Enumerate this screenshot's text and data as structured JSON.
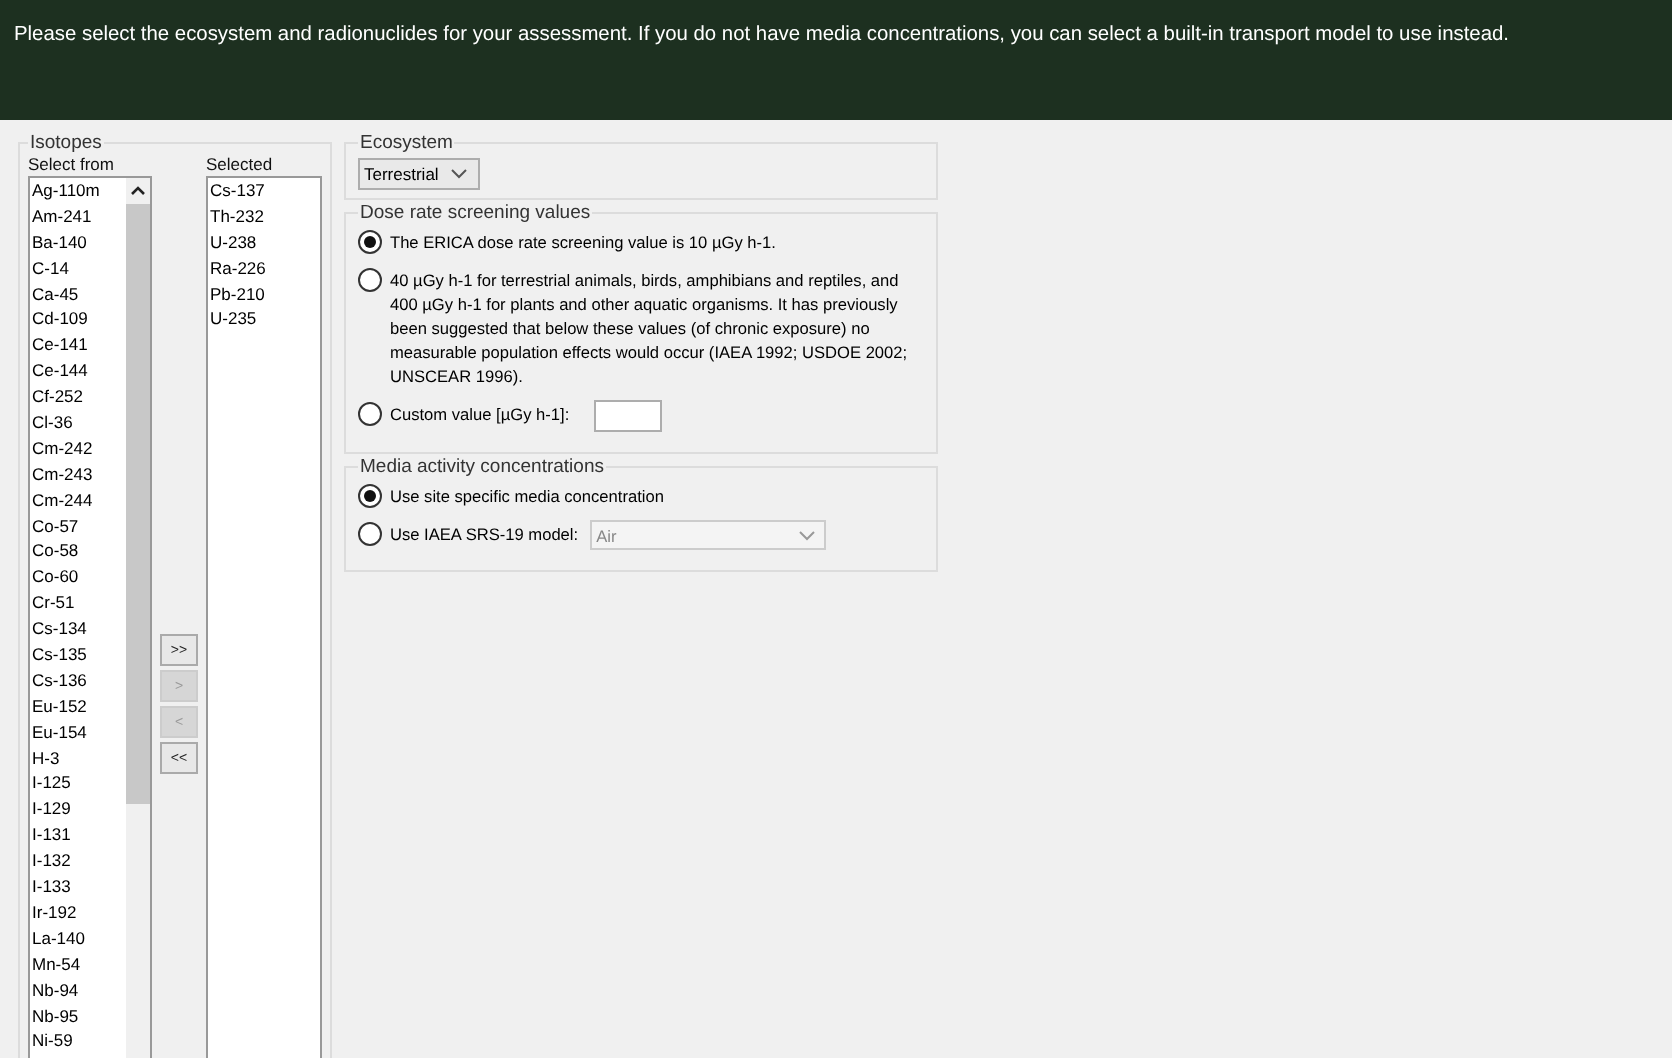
{
  "banner": {
    "text": "Please select the ecosystem and radionuclides for your assessment. If you do not have media concentrations, you can select a built-in transport model to use instead."
  },
  "isotopes": {
    "title": "Isotopes",
    "select_from_label": "Select from",
    "selected_label": "Selected",
    "select_from": [
      "Ag-110m",
      "Am-241",
      "Ba-140",
      "C-14",
      "Ca-45",
      "Cd-109",
      "Ce-141",
      "Ce-144",
      "Cf-252",
      "Cl-36",
      "Cm-242",
      "Cm-243",
      "Cm-244",
      "Co-57",
      "Co-58",
      "Co-60",
      "Cr-51",
      "Cs-134",
      "Cs-135",
      "Cs-136",
      "Eu-152",
      "Eu-154",
      "H-3",
      "I-125",
      "I-129",
      "I-131",
      "I-132",
      "I-133",
      "Ir-192",
      "La-140",
      "Mn-54",
      "Nb-94",
      "Nb-95",
      "Ni-59"
    ],
    "selected": [
      "Cs-137",
      "Th-232",
      "U-238",
      "Ra-226",
      "Pb-210",
      "U-235"
    ],
    "buttons": [
      {
        "label": ">>",
        "disabled": false
      },
      {
        "label": ">",
        "disabled": true
      },
      {
        "label": "<",
        "disabled": true
      },
      {
        "label": "<<",
        "disabled": false
      }
    ]
  },
  "ecosystem": {
    "title": "Ecosystem",
    "value": "Terrestrial"
  },
  "dose_rate": {
    "title": "Dose rate screening values",
    "options": [
      {
        "kind": "text",
        "label": "The ERICA dose rate screening value is 10 µGy h-1.",
        "selected": true
      },
      {
        "kind": "text",
        "label": "40 µGy h-1 for terrestrial animals, birds, amphibians and reptiles, and 400 µGy h-1 for plants and other aquatic organisms. It has previously been suggested that below these values (of chronic exposure) no measurable population effects would occur (IAEA 1992; USDOE 2002; UNSCEAR 1996).",
        "selected": false
      },
      {
        "kind": "input",
        "label": "Custom value [µGy h-1]:",
        "selected": false
      }
    ]
  },
  "media": {
    "title": "Media activity concentrations",
    "options": [
      {
        "kind": "text",
        "label": "Use site specific media concentration",
        "selected": true
      },
      {
        "kind": "dropdown",
        "label": "Use IAEA SRS-19 model:",
        "selected": false,
        "value": "Air",
        "disabled": true
      }
    ]
  }
}
